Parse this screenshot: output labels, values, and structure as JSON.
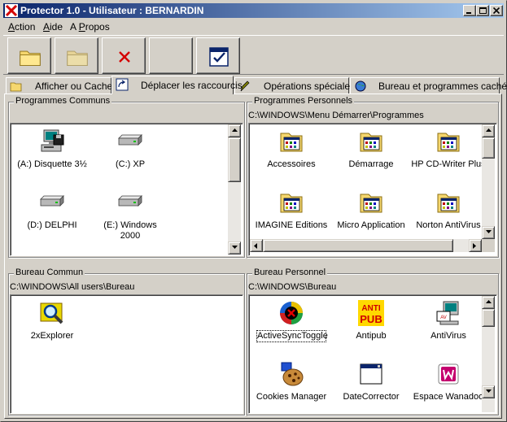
{
  "window": {
    "title": "Protector 1.0 - Utilisateur : BERNARDIN"
  },
  "menu": [
    {
      "label": "Action",
      "underline": "A"
    },
    {
      "label": "Aide",
      "underline": "A"
    },
    {
      "label": "A Propos",
      "underline": "P"
    }
  ],
  "toolbar": {
    "buttons": [
      "open-folder",
      "folder-disabled",
      "delete",
      "empty",
      "checklist"
    ]
  },
  "tabs": [
    {
      "label": "Afficher ou Cacher",
      "icon": "folder-open-icon"
    },
    {
      "label": "Déplacer les raccourcis",
      "icon": "shortcut-icon"
    },
    {
      "label": "Opérations spéciales",
      "icon": "pen-icon"
    },
    {
      "label": "Bureau et programmes cachés",
      "icon": "globe-icon"
    }
  ],
  "active_tab": "Déplacer les raccourcis",
  "panels": {
    "programmes_communs": {
      "title": "Programmes Communs",
      "items": [
        {
          "label": "(A:)  Disquette 3½",
          "icon": "floppy-computer-icon"
        },
        {
          "label": "(C:) XP",
          "icon": "hard-drive-icon"
        },
        {
          "label": "(D:)  DELPHI",
          "icon": "hard-drive-icon"
        },
        {
          "label": "(E:)  Windows",
          "label2": "2000",
          "icon": "hard-drive-icon"
        }
      ]
    },
    "programmes_personnels": {
      "title": "Programmes Personnels",
      "path": "C:\\WINDOWS\\Menu Démarrer\\Programmes",
      "items": [
        {
          "label": "Accessoires",
          "icon": "program-group-icon"
        },
        {
          "label": "Démarrage",
          "icon": "program-group-icon"
        },
        {
          "label": "HP CD-Writer Plus",
          "icon": "program-group-icon"
        },
        {
          "label": "IMAGINE Editions",
          "icon": "program-group-icon"
        },
        {
          "label": "Micro Application",
          "icon": "program-group-icon"
        },
        {
          "label": "Norton AntiVirus",
          "icon": "program-group-icon"
        }
      ]
    },
    "bureau_commun": {
      "title": "Bureau Commun",
      "path": "C:\\WINDOWS\\All users\\Bureau",
      "items": [
        {
          "label": "2xExplorer",
          "icon": "magnifier-icon"
        }
      ]
    },
    "bureau_personnel": {
      "title": "Bureau Personnel",
      "path": "C:\\WINDOWS\\Bureau",
      "items": [
        {
          "label": "ActiveSyncToggle",
          "icon": "activesync-icon",
          "selected": true
        },
        {
          "label": "Antipub",
          "icon": "antipub-icon",
          "badge1": "ANTI",
          "badge2": "PUB"
        },
        {
          "label": "AntiVirus",
          "icon": "antivirus-icon"
        },
        {
          "label": "Cookies Manager",
          "icon": "cookie-icon"
        },
        {
          "label": "DateCorrector",
          "icon": "window-icon"
        },
        {
          "label": "Espace Wanadoo",
          "icon": "wanadoo-icon"
        }
      ]
    }
  },
  "colors": {
    "face": "#d4d0c8",
    "title_start": "#0a246a",
    "title_end": "#a6caf0",
    "folder": "#f5d76e",
    "delete_x": "#d40000"
  }
}
